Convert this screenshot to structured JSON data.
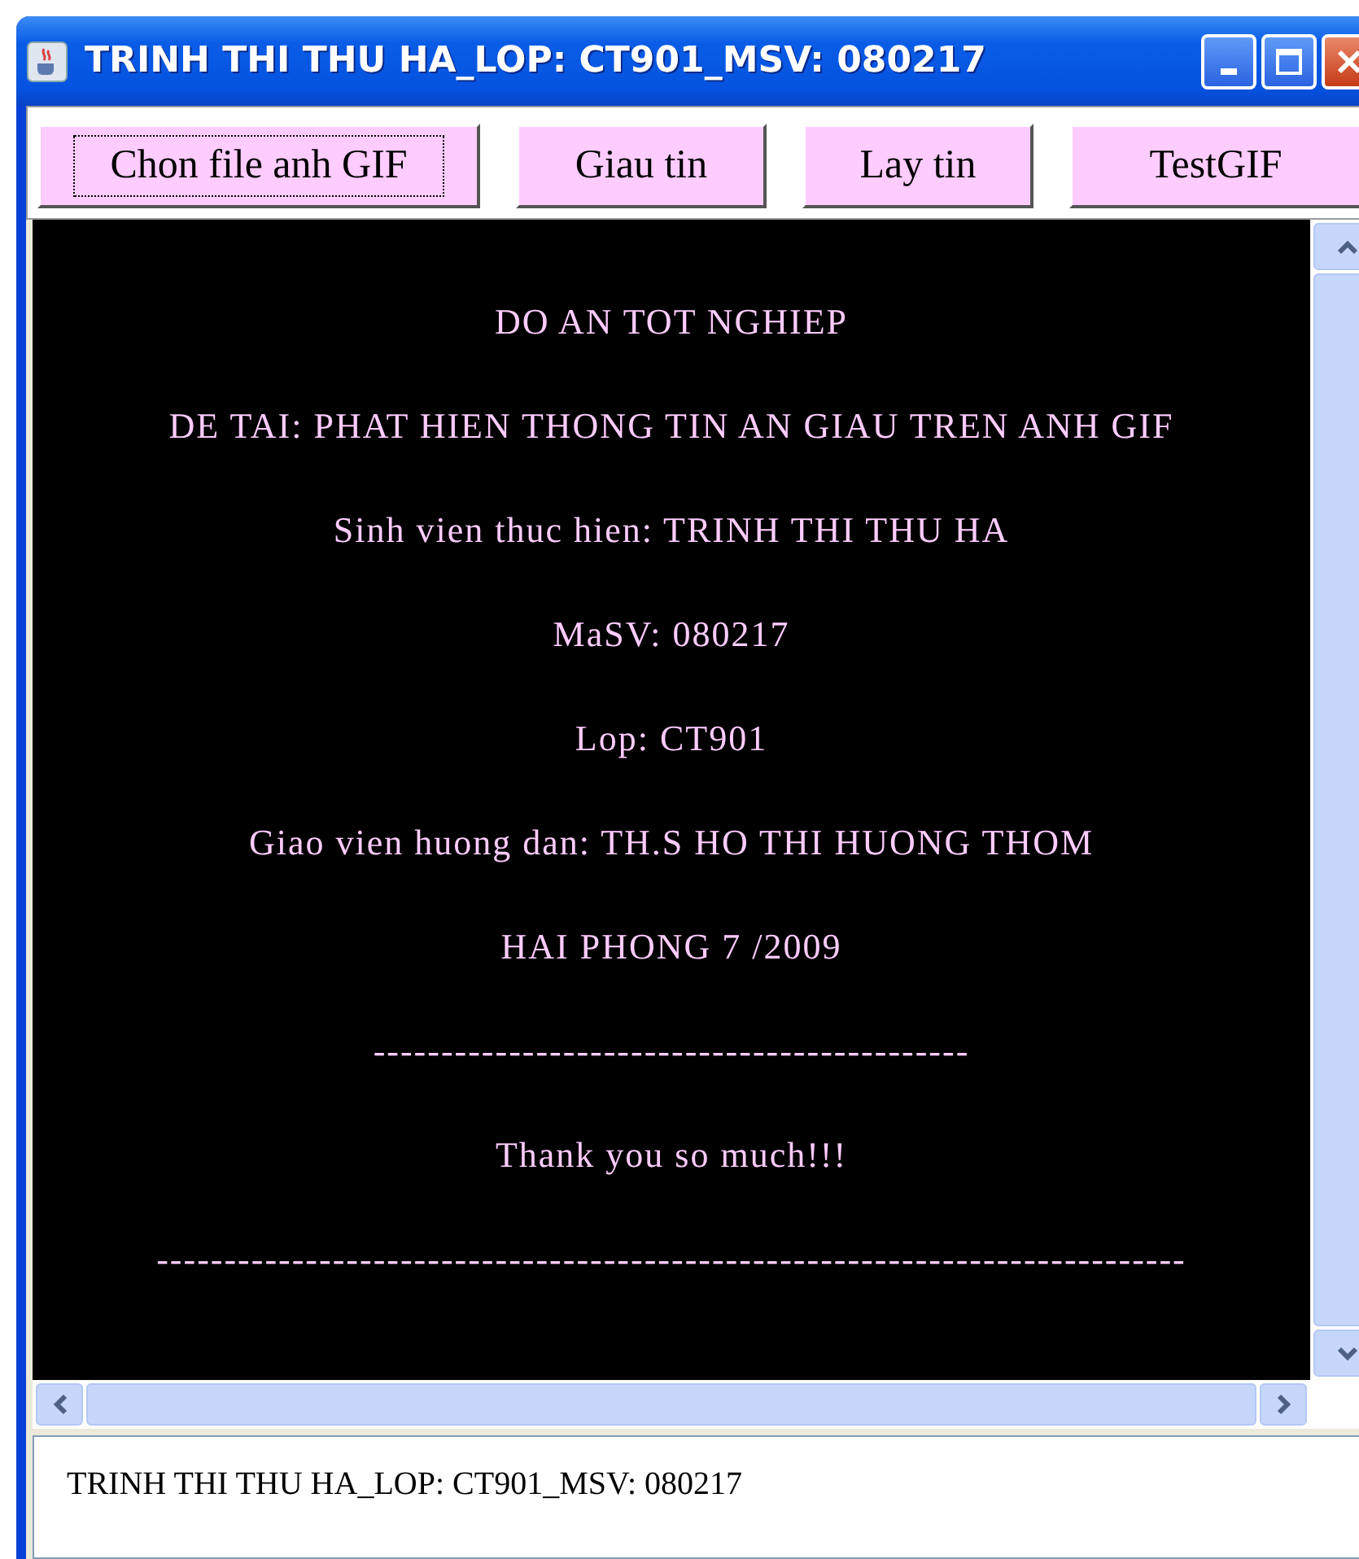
{
  "window": {
    "title": "TRINH THI THU HA_LOP: CT901_MSV: 080217"
  },
  "toolbar": {
    "buttons": [
      {
        "label": "Chon file anh GIF",
        "focused": true
      },
      {
        "label": "Giau tin",
        "focused": false
      },
      {
        "label": "Lay tin",
        "focused": false
      },
      {
        "label": "TestGIF",
        "focused": false
      }
    ]
  },
  "content": {
    "lines": [
      "DO AN TOT NGHIEP",
      "DE TAI: PHAT HIEN THONG TIN AN GIAU TREN ANH GIF",
      "Sinh vien thuc hien: TRINH THI THU HA",
      "MaSV: 080217",
      "Lop: CT901",
      "Giao vien huong dan: TH.S HO THI HUONG THOM",
      "HAI PHONG 7 /2009",
      "--------------------------------------------",
      "Thank you so much!!!",
      "----------------------------------------------------------------------------"
    ]
  },
  "status_field": {
    "value": "TRINH THI THU HA_LOP: CT901_MSV: 080217"
  }
}
